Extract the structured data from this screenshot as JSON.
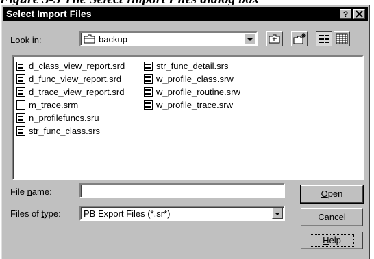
{
  "caption": "Figure 3-3  The Select Import Files dialog box",
  "window": {
    "title": "Select Import Files",
    "help_button": "?",
    "close_button": "X"
  },
  "look_in": {
    "label_prefix": "Look ",
    "label_mnemonic": "i",
    "label_suffix": "n:",
    "value": "backup",
    "icon": "folder-icon"
  },
  "toolbar": {
    "buttons": [
      {
        "name": "up-one-level",
        "icon": "up-folder-icon"
      },
      {
        "name": "create-new-folder",
        "icon": "new-folder-icon"
      },
      {
        "name": "list-view",
        "icon": "list-view-icon",
        "pressed": true
      },
      {
        "name": "details-view",
        "icon": "details-view-icon",
        "pressed": false
      }
    ]
  },
  "files": [
    {
      "name": "d_class_view_report.srd",
      "icon": "datawindow-icon"
    },
    {
      "name": "d_func_view_report.srd",
      "icon": "datawindow-icon"
    },
    {
      "name": "d_trace_view_report.srd",
      "icon": "datawindow-icon"
    },
    {
      "name": "m_trace.srm",
      "icon": "menu-file-icon"
    },
    {
      "name": "n_profilefuncs.sru",
      "icon": "datawindow-icon"
    },
    {
      "name": "str_func_class.srs",
      "icon": "datawindow-icon"
    },
    {
      "name": "str_func_detail.srs",
      "icon": "datawindow-icon"
    },
    {
      "name": "w_profile_class.srw",
      "icon": "window-file-icon"
    },
    {
      "name": "w_profile_routine.srw",
      "icon": "window-file-icon"
    },
    {
      "name": "w_profile_trace.srw",
      "icon": "window-file-icon"
    }
  ],
  "file_name": {
    "label_prefix": "File ",
    "label_mnemonic": "n",
    "label_suffix": "ame:",
    "value": ""
  },
  "file_type": {
    "label_prefix": "Files of ",
    "label_mnemonic": "t",
    "label_suffix": "ype:",
    "value": "PB Export Files (*.sr*)"
  },
  "buttons": {
    "open_mnemonic": "O",
    "open_rest": "pen",
    "cancel": "Cancel",
    "help_mnemonic": "H",
    "help_rest": "elp"
  }
}
